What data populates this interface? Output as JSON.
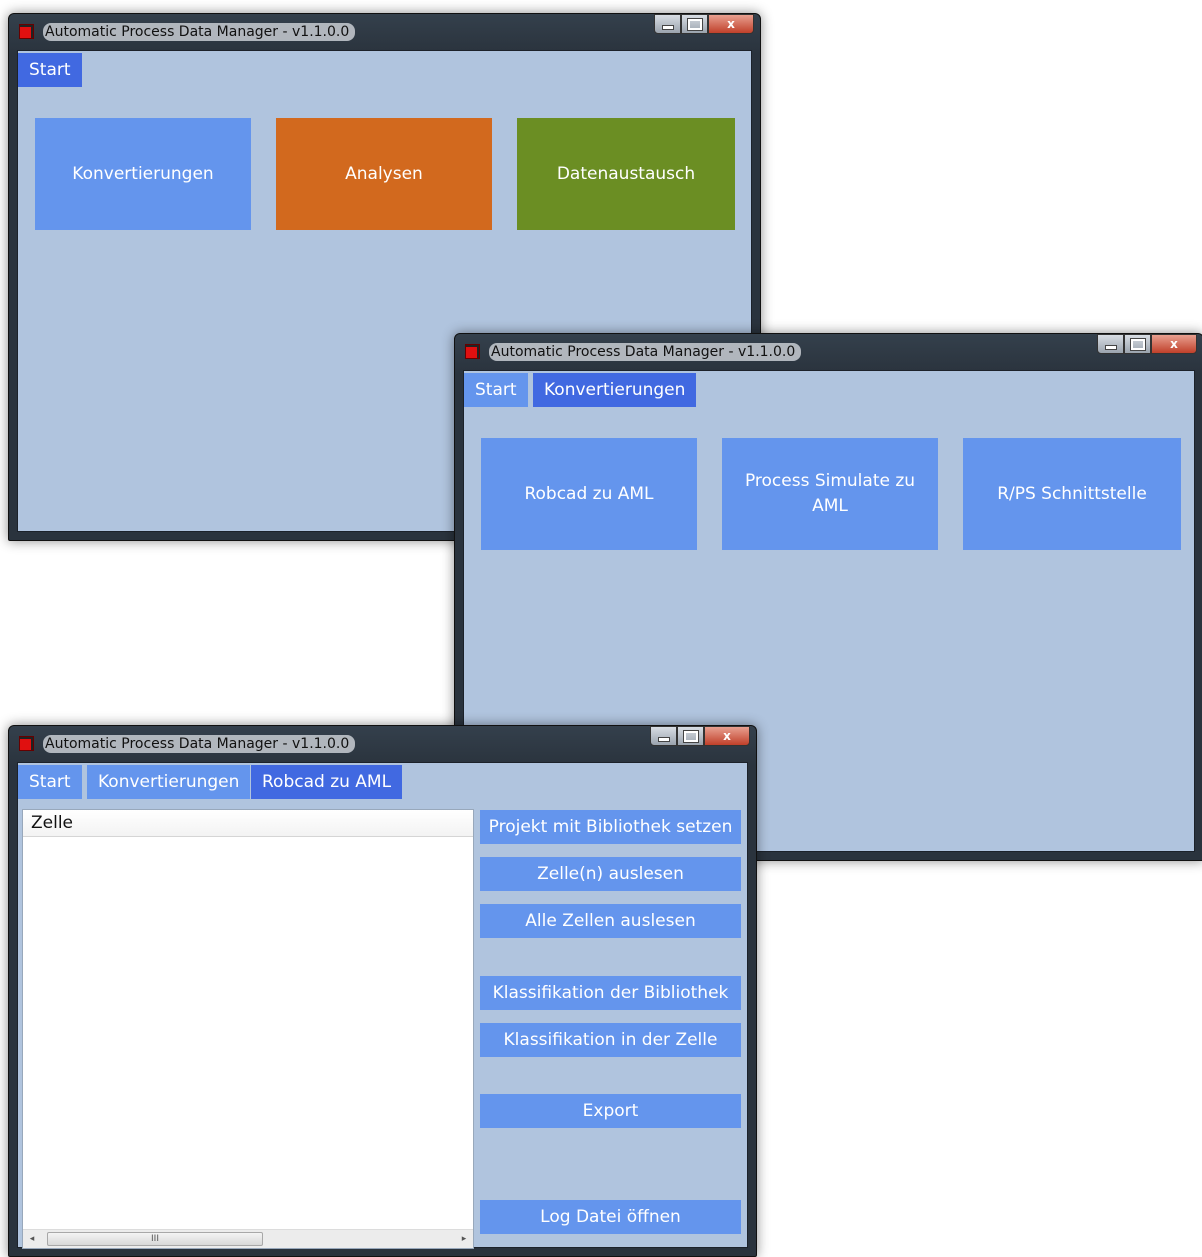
{
  "app": {
    "title": "Automatic Process Data Manager - v1.1.0.0",
    "icon": "app-red-square-icon"
  },
  "window_controls": {
    "close_label": "x"
  },
  "window1": {
    "tabs": [
      {
        "label": "Start",
        "active": true
      }
    ],
    "tiles": [
      {
        "label": "Konvertierungen",
        "color": "#6495ed"
      },
      {
        "label": "Analysen",
        "color": "#d2691e"
      },
      {
        "label": "Datenaustausch",
        "color": "#6b8e23"
      }
    ]
  },
  "window2": {
    "tabs": [
      {
        "label": "Start",
        "active": false
      },
      {
        "label": "Konvertierungen",
        "active": true
      }
    ],
    "tiles": [
      {
        "label": "Robcad zu AML",
        "color": "#6495ed"
      },
      {
        "label": "Process Simulate zu AML",
        "color": "#6495ed"
      },
      {
        "label": "R/PS Schnittstelle",
        "color": "#6495ed"
      }
    ]
  },
  "window3": {
    "tabs": [
      {
        "label": "Start",
        "active": false
      },
      {
        "label": "Konvertierungen",
        "active": false
      },
      {
        "label": "Robcad zu AML",
        "active": true
      }
    ],
    "list": {
      "column_header": "Zelle",
      "scroll_grip": "III"
    },
    "actions": [
      "Projekt mit Bibliothek setzen",
      "Zelle(n) auslesen",
      "Alle Zellen auslesen",
      "Klassifikation der Bibliothek",
      "Klassifikation in der Zelle",
      "Export",
      "Log Datei öffnen"
    ]
  },
  "colors": {
    "client_bg": "#b0c4de",
    "tile_blue": "#6495ed",
    "tab_active": "#4169e1",
    "tile_orange": "#d2691e",
    "tile_green": "#6b8e23"
  }
}
